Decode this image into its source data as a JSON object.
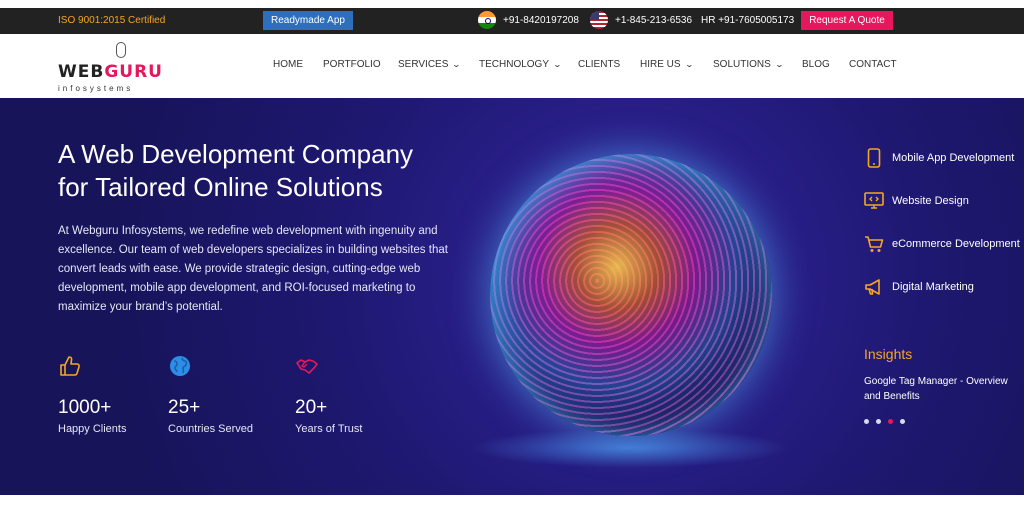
{
  "topbar": {
    "iso": "ISO 9001:2015 Certified",
    "readymade_label": "Readymade App",
    "phone_india": "+91-8420197208",
    "phone_us": "+1-845-213-6536",
    "phone_hr": "HR +91-7605005173",
    "quote_label": "Request A Quote"
  },
  "logo": {
    "main_left": "WEB",
    "main_accent": "GURU",
    "sub": "infosystems"
  },
  "nav": {
    "home": "HOME",
    "portfolio": "PORTFOLIO",
    "services": "SERVICES",
    "technology": "TECHNOLOGY",
    "clients": "CLIENTS",
    "hire_us": "HIRE US",
    "solutions": "SOLUTIONS",
    "blog": "BLOG",
    "contact": "CONTACT"
  },
  "hero": {
    "title_line1": "A Web Development Company",
    "title_line2": "for Tailored Online Solutions",
    "description": "At Webguru Infosystems, we redefine web development with ingenuity and excellence. Our team of web developers specializes in building websites that convert leads with ease. We provide strategic design, cutting-edge web development, mobile app development, and ROI-focused marketing to maximize your brand’s potential.",
    "stats": [
      {
        "number": "1000+",
        "label": "Happy Clients",
        "icon": "thumbs-up-icon"
      },
      {
        "number": "25+",
        "label": "Countries Served",
        "icon": "globe-icon"
      },
      {
        "number": "20+",
        "label": "Years of Trust",
        "icon": "handshake-icon"
      }
    ]
  },
  "services": [
    {
      "label": "Mobile App Development",
      "icon": "mobile-icon"
    },
    {
      "label": "Website Design",
      "icon": "monitor-code-icon"
    },
    {
      "label": "eCommerce Development",
      "icon": "cart-icon"
    },
    {
      "label": "Digital Marketing",
      "icon": "megaphone-icon"
    }
  ],
  "insights": {
    "title": "Insights",
    "article": "Google Tag Manager - Overview and Benefits",
    "active_dot": 2,
    "dot_count": 4
  },
  "colors": {
    "accent_pink": "#e8175d",
    "accent_orange": "#f5a623",
    "button_blue": "#2d6fbd",
    "hero_bg": "#1e1870"
  }
}
